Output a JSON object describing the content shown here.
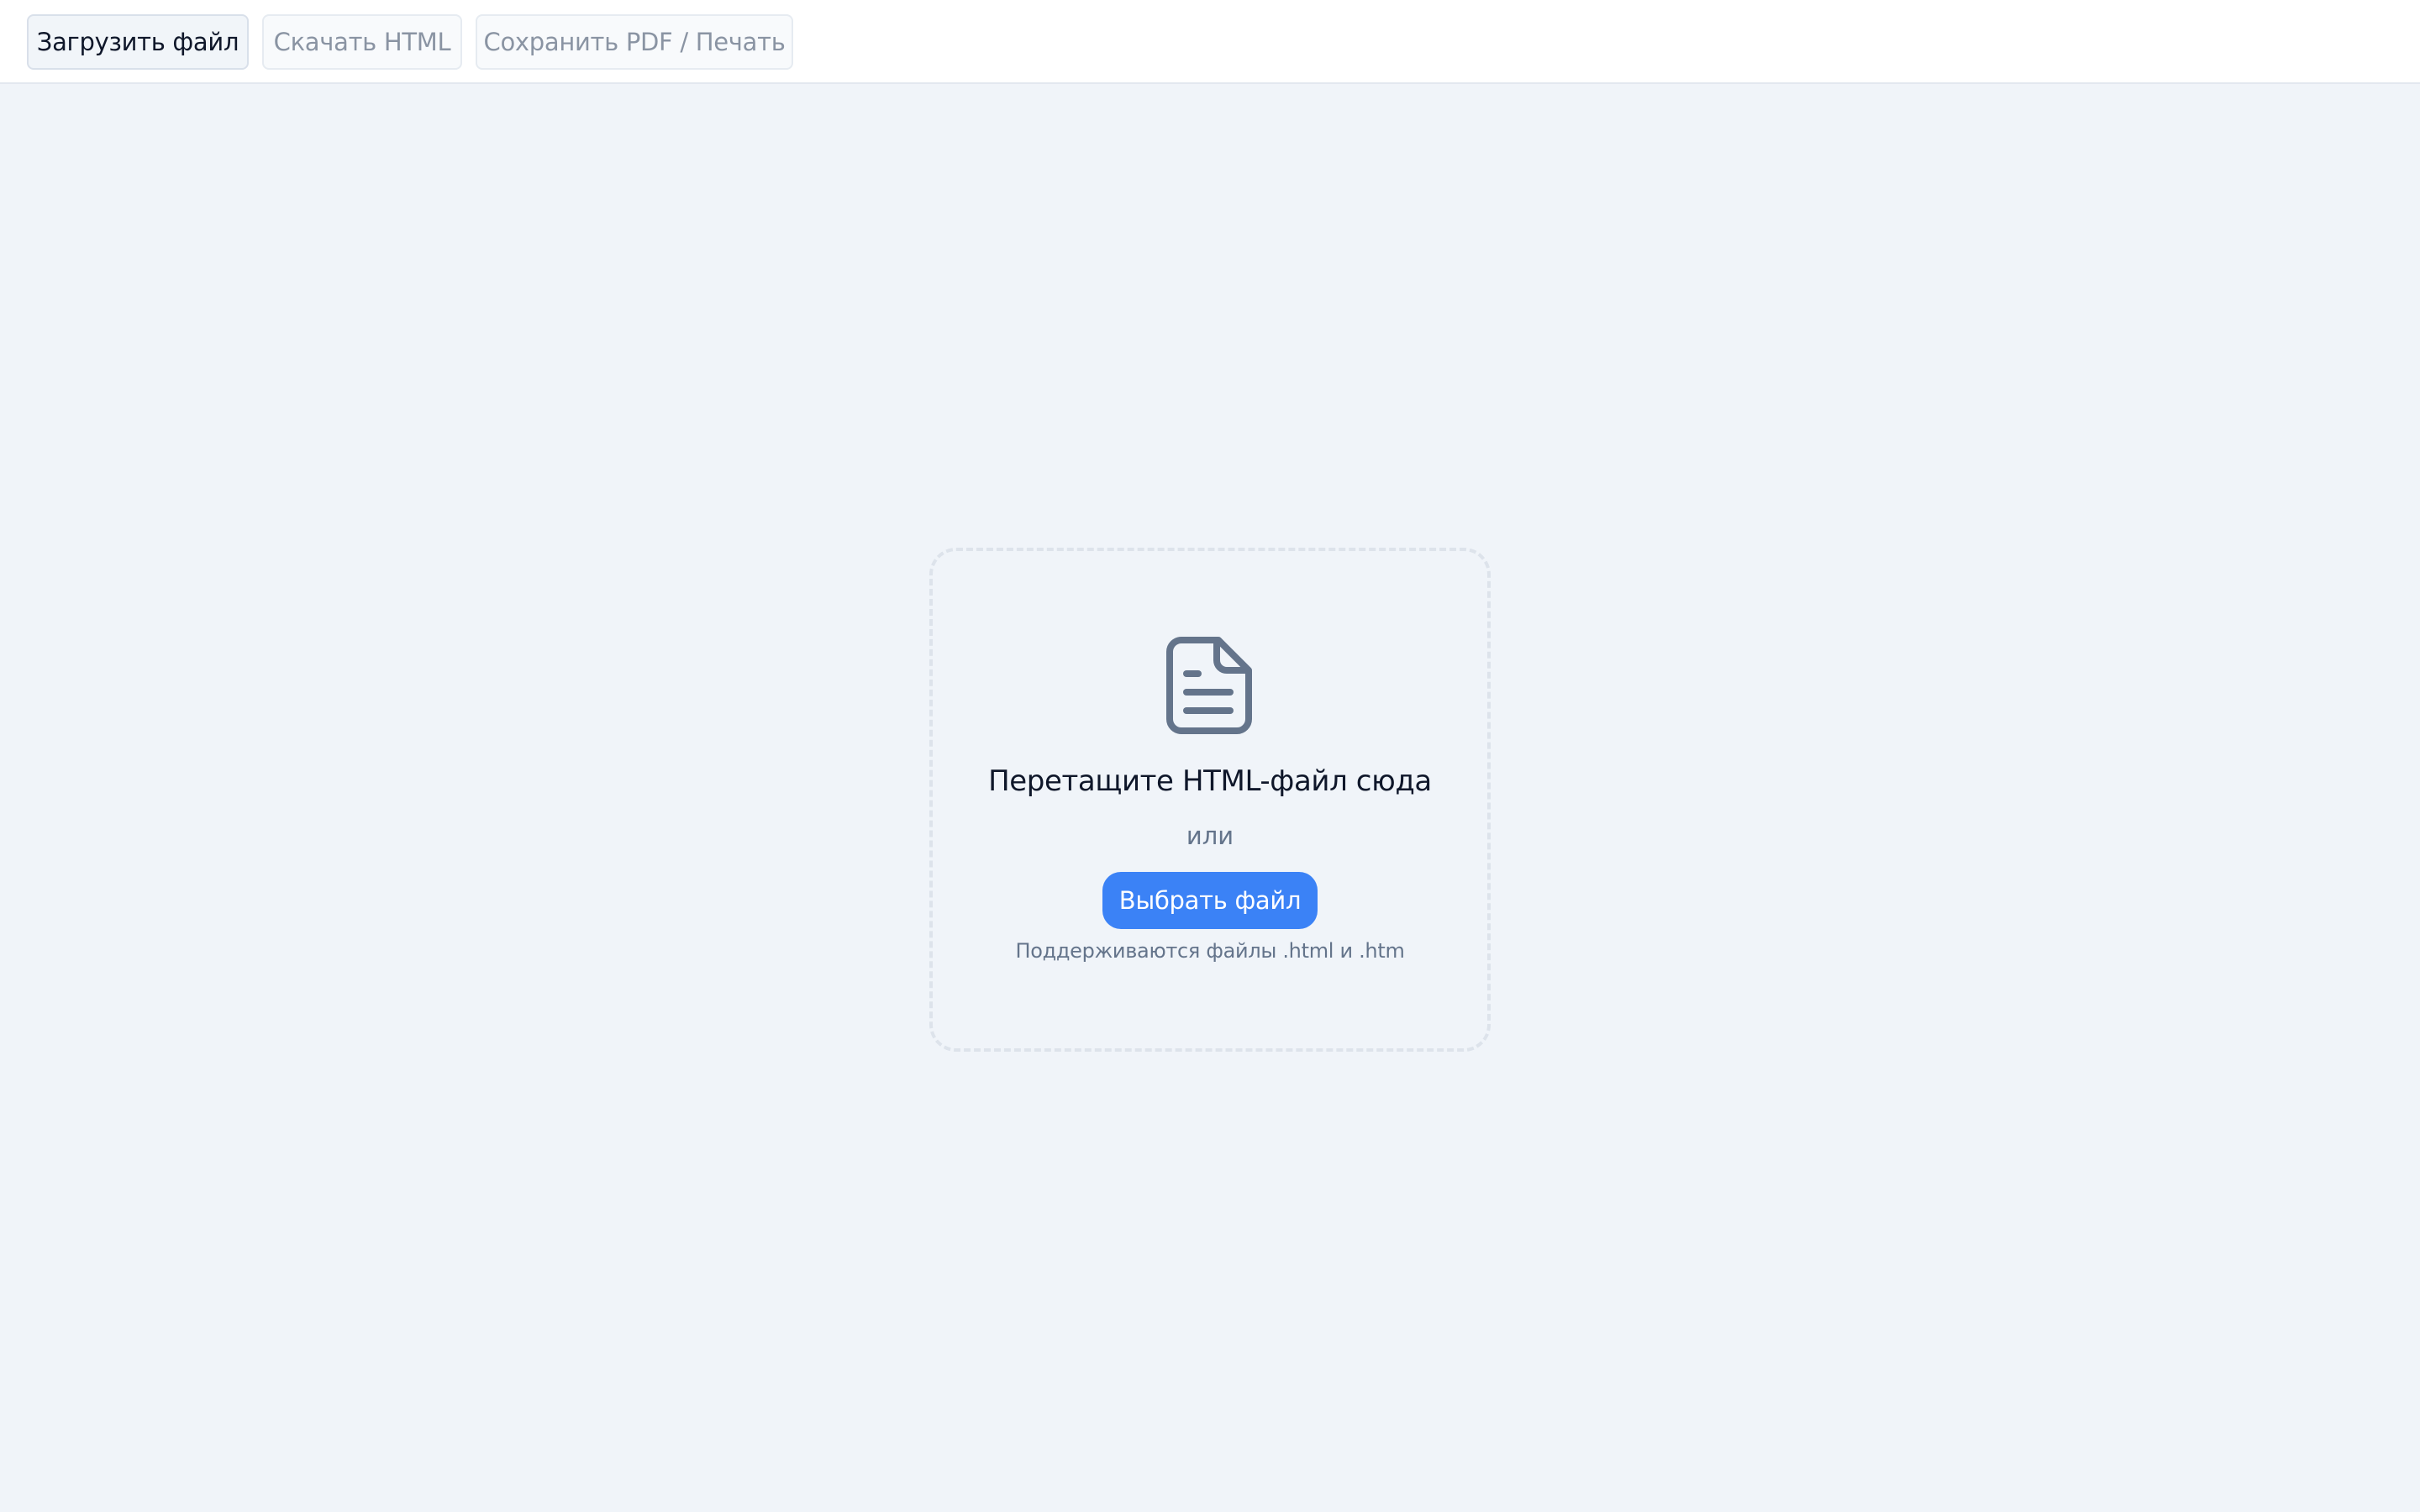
{
  "toolbar": {
    "upload_label": "Загрузить файл",
    "download_label": "Скачать HTML",
    "pdf_label": "Сохранить PDF / Печать"
  },
  "dropzone": {
    "icon": "document-icon",
    "title": "Перетащите HTML-файл сюда",
    "or_text": "или",
    "choose_label": "Выбрать файл",
    "hint": "Поддерживаются файлы .html и .htm"
  },
  "colors": {
    "accent": "#3b82f6",
    "background": "#f0f4f9",
    "icon": "#64748b"
  }
}
